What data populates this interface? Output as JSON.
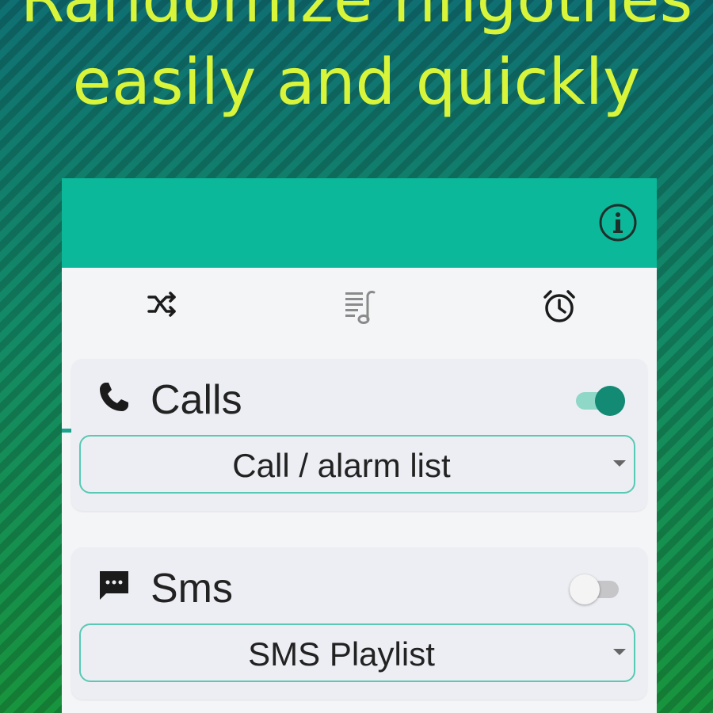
{
  "promo": {
    "line1": "Randomize ringotnes",
    "line2": "easily and quickly"
  },
  "colors": {
    "accent": "#0cb89a",
    "headline": "#d8f53a",
    "toggle_on": "#128a74"
  },
  "appbar": {
    "actions": [
      {
        "icon": "info-icon"
      }
    ]
  },
  "tabs": [
    {
      "icon": "shuffle-icon",
      "selected": true
    },
    {
      "icon": "playlist-icon",
      "selected": false
    },
    {
      "icon": "alarm-clock-icon",
      "selected": false
    }
  ],
  "cards": [
    {
      "icon": "phone-icon",
      "title": "Calls",
      "enabled": true,
      "selected_list": "Call / alarm list"
    },
    {
      "icon": "message-icon",
      "title": "Sms",
      "enabled": false,
      "selected_list": "SMS Playlist"
    }
  ]
}
